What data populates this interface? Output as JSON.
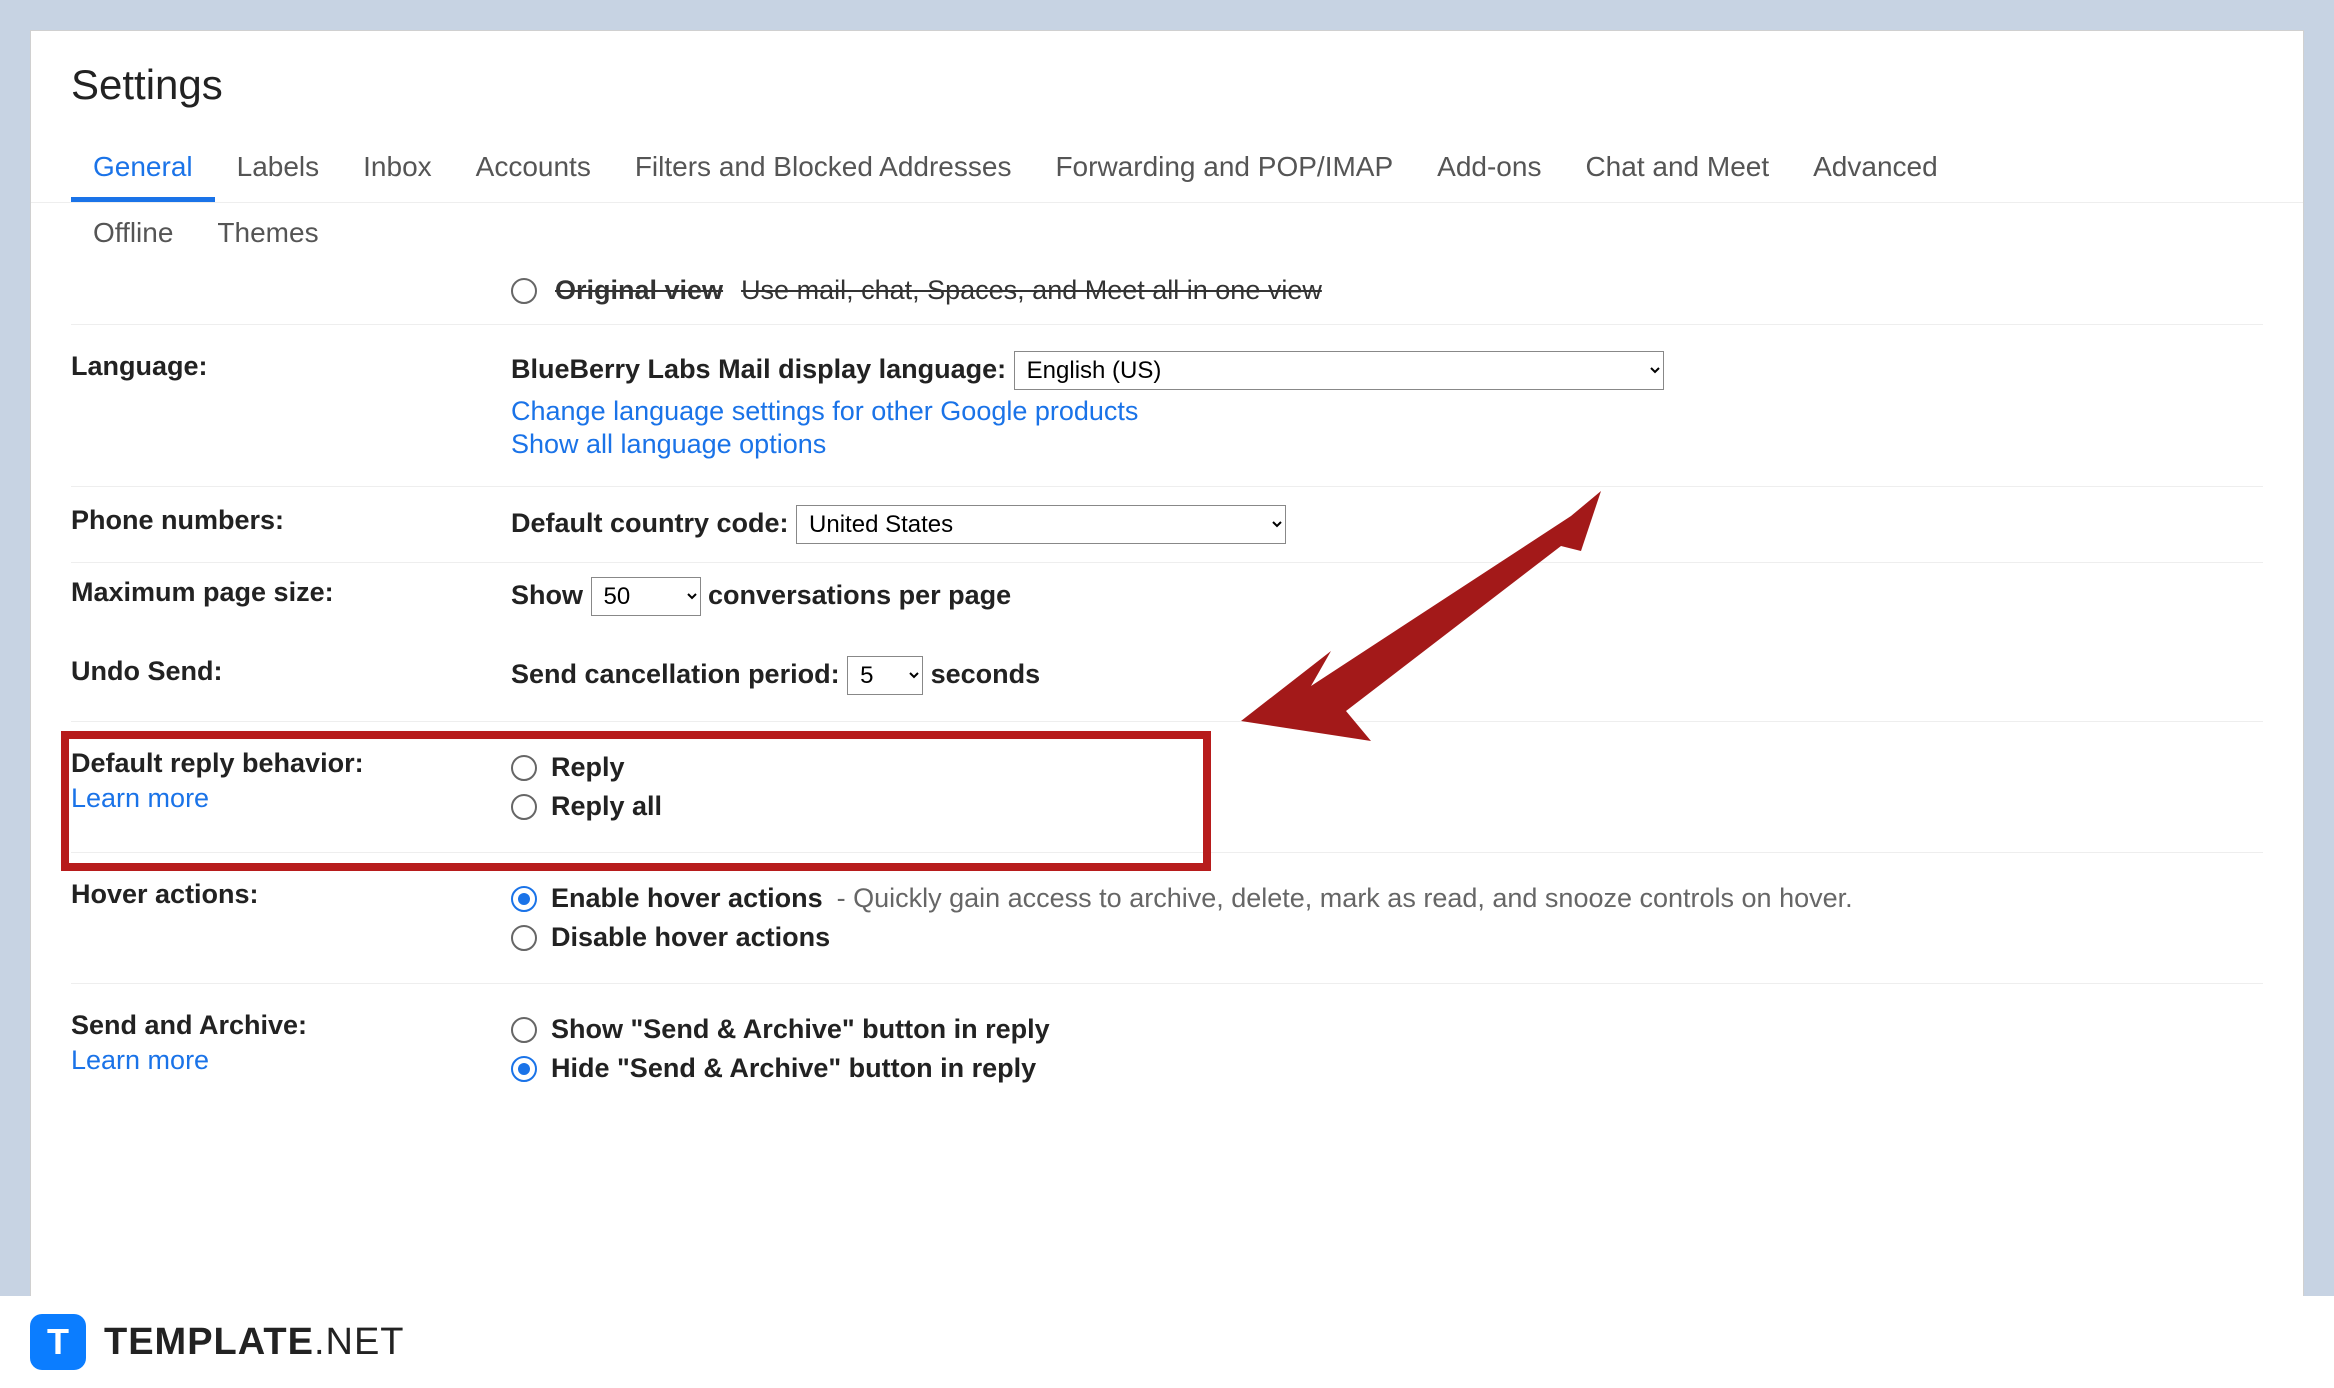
{
  "header": {
    "title": "Settings"
  },
  "tabs": {
    "row1": [
      "General",
      "Labels",
      "Inbox",
      "Accounts",
      "Filters and Blocked Addresses",
      "Forwarding and POP/IMAP",
      "Add-ons",
      "Chat and Meet",
      "Advanced"
    ],
    "row2": [
      "Offline",
      "Themes"
    ],
    "active": "General"
  },
  "cut": {
    "label1": "Original view",
    "label2": "Use mail, chat, Spaces, and Meet all in one view"
  },
  "language": {
    "label": "Language:",
    "prefix": "BlueBerry Labs Mail display language:",
    "value": "English (US)",
    "link1": "Change language settings for other Google products",
    "link2": "Show all language options"
  },
  "phone": {
    "label": "Phone numbers:",
    "prefix": "Default country code:",
    "value": "United States"
  },
  "pagesize": {
    "label": "Maximum page size:",
    "prefix": "Show",
    "value": "50",
    "suffix": "conversations per page"
  },
  "undo": {
    "label": "Undo Send:",
    "prefix": "Send cancellation period:",
    "value": "5",
    "suffix": "seconds"
  },
  "reply": {
    "label": "Default reply behavior:",
    "learn": "Learn more",
    "opt1": "Reply",
    "opt2": "Reply all"
  },
  "hover": {
    "label": "Hover actions:",
    "opt1": "Enable hover actions",
    "opt1desc": " - Quickly gain access to archive, delete, mark as read, and snooze controls on hover.",
    "opt2": "Disable hover actions"
  },
  "archive": {
    "label": "Send and Archive:",
    "learn": "Learn more",
    "opt1": "Show \"Send & Archive\" button in reply",
    "opt2": "Hide \"Send & Archive\" button in reply"
  },
  "footer": {
    "logo": "T",
    "brand1": "TEMPLATE",
    "brand2": ".NET"
  }
}
